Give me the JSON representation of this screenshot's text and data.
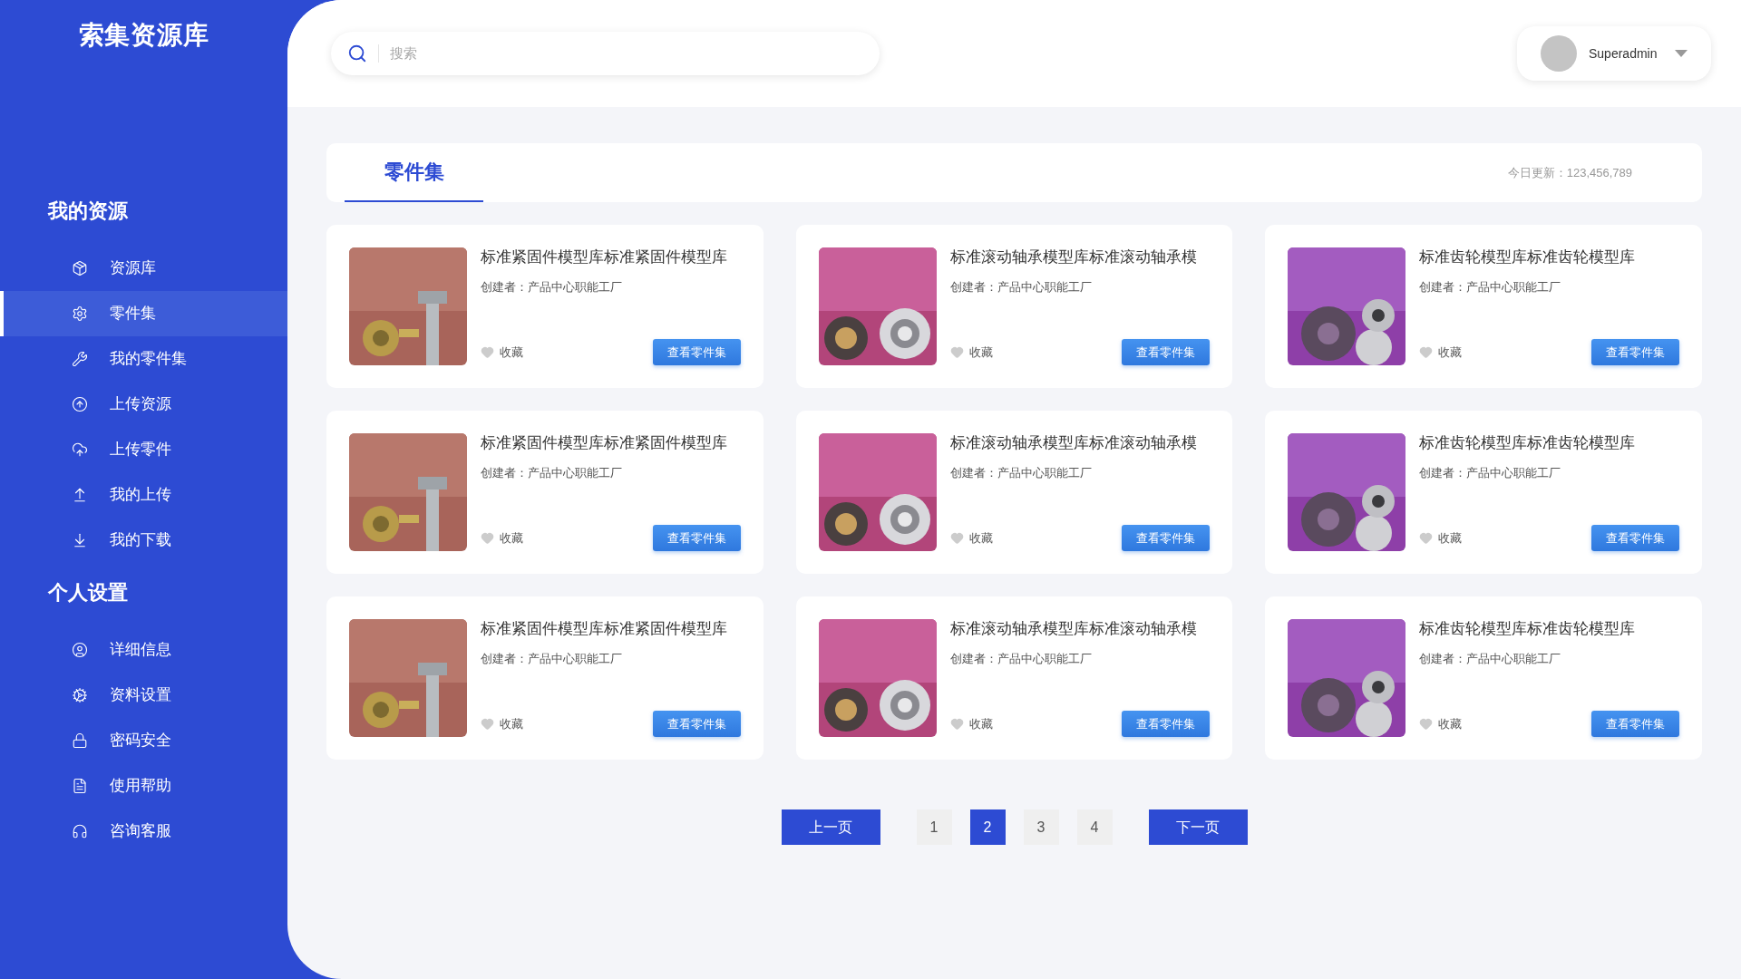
{
  "sidebar": {
    "logo": "索集资源库",
    "sections": [
      {
        "title": "我的资源",
        "items": [
          {
            "label": "资源库",
            "selected": false
          },
          {
            "label": "零件集",
            "selected": true
          },
          {
            "label": "我的零件集",
            "selected": false
          },
          {
            "label": "上传资源",
            "selected": false
          },
          {
            "label": "上传零件",
            "selected": false
          },
          {
            "label": "我的上传",
            "selected": false
          },
          {
            "label": "我的下载",
            "selected": false
          }
        ]
      },
      {
        "title": "个人设置",
        "items": [
          {
            "label": "详细信息",
            "selected": false
          },
          {
            "label": "资料设置",
            "selected": false
          },
          {
            "label": "密码安全",
            "selected": false
          },
          {
            "label": "使用帮助",
            "selected": false
          },
          {
            "label": "咨询客服",
            "selected": false
          }
        ]
      }
    ]
  },
  "header": {
    "search": {
      "placeholder": "搜索"
    },
    "user": {
      "name": "Superadmin"
    }
  },
  "tabs": [
    {
      "label": "零件集",
      "selected": true
    }
  ],
  "update_info": "今日更新：123,456,789",
  "cards": [
    {
      "title": "标准紧固件模型库标准紧固件模型库",
      "creator": "创建者：产品中心职能工厂",
      "favorite_label": "收藏",
      "favorited": false,
      "button": "查看零件集"
    },
    {
      "title": "标准滚动轴承模型库标准滚动轴承模",
      "creator": "创建者：产品中心职能工厂",
      "favorite_label": "收藏",
      "favorited": false,
      "button": "查看零件集"
    },
    {
      "title": "标准齿轮模型库标准齿轮模型库",
      "creator": "创建者：产品中心职能工厂",
      "favorite_label": "收藏",
      "favorited": false,
      "button": "查看零件集"
    },
    {
      "title": "标准紧固件模型库标准紧固件模型库",
      "creator": "创建者：产品中心职能工厂",
      "favorite_label": "收藏",
      "favorited": false,
      "button": "查看零件集"
    },
    {
      "title": "标准滚动轴承模型库标准滚动轴承模",
      "creator": "创建者：产品中心职能工厂",
      "favorite_label": "收藏",
      "favorited": false,
      "button": "查看零件集"
    },
    {
      "title": "标准齿轮模型库标准齿轮模型库",
      "creator": "创建者：产品中心职能工厂",
      "favorite_label": "收藏",
      "favorited": false,
      "button": "查看零件集"
    },
    {
      "title": "标准紧固件模型库标准紧固件模型库",
      "creator": "创建者：产品中心职能工厂",
      "favorite_label": "收藏",
      "favorited": false,
      "button": "查看零件集"
    },
    {
      "title": "标准滚动轴承模型库标准滚动轴承模",
      "creator": "创建者：产品中心职能工厂",
      "favorite_label": "收藏",
      "favorited": false,
      "button": "查看零件集"
    },
    {
      "title": "标准齿轮模型库标准齿轮模型库",
      "creator": "创建者：产品中心职能工厂",
      "favorite_label": "收藏",
      "favorited": false,
      "button": "查看零件集"
    }
  ],
  "pagination": {
    "prev": "上一页",
    "pages": [
      {
        "label": "1",
        "selected": false
      },
      {
        "label": "2",
        "selected": true
      },
      {
        "label": "3",
        "selected": false
      },
      {
        "label": "4",
        "selected": false
      }
    ],
    "next": "下一页"
  }
}
